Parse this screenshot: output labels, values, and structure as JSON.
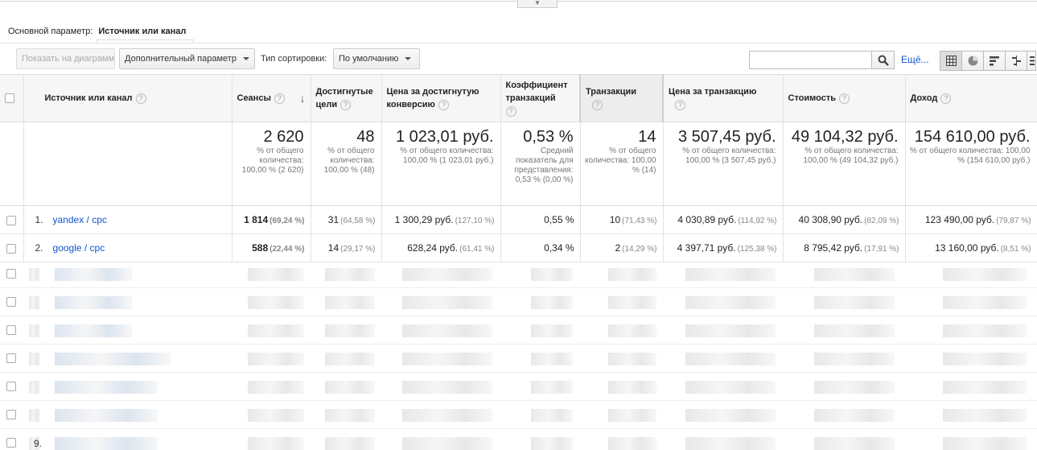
{
  "primary_dimension": {
    "label": "Основной параметр:",
    "value": "Источник или канал"
  },
  "toolbar": {
    "show_chart": "Показать на диаграмме",
    "secondary_param": "Дополнительный параметр",
    "sort_type_label": "Тип сортировки:",
    "sort_type_value": "По умолчанию",
    "search_placeholder": "",
    "more": "Ещё..."
  },
  "columns": {
    "source": "Источник или канал",
    "sessions": "Сеансы",
    "goals": "Достигнутые цели",
    "cost_per_goal": "Цена за достигнутую конверсию",
    "trans_rate": "Коэффициент транзакций",
    "transactions": "Транзакции",
    "cost_per_trans": "Цена за транзакцию",
    "cost": "Стоимость",
    "revenue": "Доход"
  },
  "totals": {
    "sessions": {
      "value": "2 620",
      "note": "% от общего количества: 100,00 % (2 620)"
    },
    "goals": {
      "value": "48",
      "note": "% от общего количества: 100,00 % (48)"
    },
    "cost_per_goal": {
      "value": "1 023,01 руб.",
      "note": "% от общего количества: 100,00 % (1 023,01 руб.)"
    },
    "trans_rate": {
      "value": "0,53 %",
      "note": "Средний показатель для представления: 0,53 % (0,00 %)"
    },
    "transactions": {
      "value": "14",
      "note": "% от общего количества: 100,00 % (14)"
    },
    "cost_per_trans": {
      "value": "3 507,45 руб.",
      "note": "% от общего количества: 100,00 % (3 507,45 руб.)"
    },
    "cost": {
      "value": "49 104,32 руб.",
      "note": "% от общего количества: 100,00 % (49 104,32 руб.)"
    },
    "revenue": {
      "value": "154 610,00 руб.",
      "note": "% от общего количества: 100,00 % (154 610,00 руб.)"
    }
  },
  "rows": [
    {
      "num": "1.",
      "source": "yandex / cpc",
      "sessions": "1 814",
      "sessions_pct": "(69,24 %)",
      "goals": "31",
      "goals_pct": "(64,58 %)",
      "cost_per_goal": "1 300,29 руб.",
      "cost_per_goal_pct": "(127,10 %)",
      "trans_rate": "0,55 %",
      "transactions": "10",
      "transactions_pct": "(71,43 %)",
      "cost_per_trans": "4 030,89 руб.",
      "cost_per_trans_pct": "(114,92 %)",
      "cost": "40 308,90 руб.",
      "cost_pct": "(82,09 %)",
      "revenue": "123 490,00 руб.",
      "revenue_pct": "(79,87 %)"
    },
    {
      "num": "2.",
      "source": "google / cpc",
      "sessions": "588",
      "sessions_pct": "(22,44 %)",
      "goals": "14",
      "goals_pct": "(29,17 %)",
      "cost_per_goal": "628,24 руб.",
      "cost_per_goal_pct": "(61,41 %)",
      "trans_rate": "0,34 %",
      "transactions": "2",
      "transactions_pct": "(14,29 %)",
      "cost_per_trans": "4 397,71 руб.",
      "cost_per_trans_pct": "(125,38 %)",
      "cost": "8 795,42 руб.",
      "cost_pct": "(17,91 %)",
      "revenue": "13 160,00 руб.",
      "revenue_pct": "(8,51 %)"
    }
  ],
  "blurred_last_num": "9.",
  "colors": {
    "link": "#1155cc",
    "header_bg": "#f6f6f6",
    "border": "#e3e3e3"
  }
}
